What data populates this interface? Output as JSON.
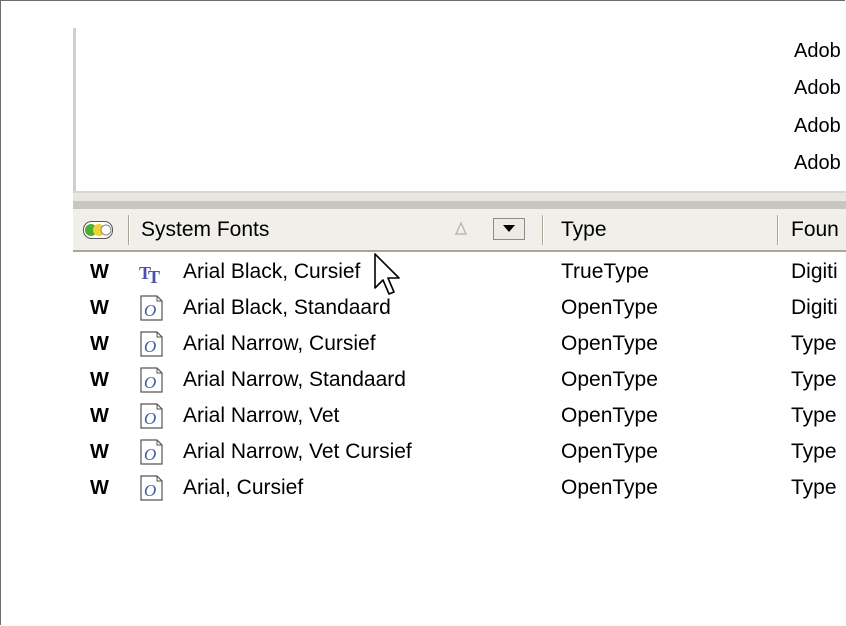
{
  "upper_pane": {
    "items": [
      "Adob",
      "Adob",
      "Adob",
      "Adob"
    ]
  },
  "header": {
    "col_name": "System Fonts",
    "col_type": "Type",
    "col_foundry": "Foun"
  },
  "rows": [
    {
      "mark": "W",
      "icon": "truetype-icon",
      "name": "Arial Black, Cursief",
      "type": "TrueType",
      "foundry": "Digiti"
    },
    {
      "mark": "W",
      "icon": "opentype-icon",
      "name": "Arial Black, Standaard",
      "type": "OpenType",
      "foundry": "Digiti"
    },
    {
      "mark": "W",
      "icon": "opentype-icon",
      "name": "Arial Narrow, Cursief",
      "type": "OpenType",
      "foundry": "Type"
    },
    {
      "mark": "W",
      "icon": "opentype-icon",
      "name": "Arial Narrow, Standaard",
      "type": "OpenType",
      "foundry": "Type"
    },
    {
      "mark": "W",
      "icon": "opentype-icon",
      "name": "Arial Narrow, Vet",
      "type": "OpenType",
      "foundry": "Type"
    },
    {
      "mark": "W",
      "icon": "opentype-icon",
      "name": "Arial Narrow, Vet Cursief",
      "type": "OpenType",
      "foundry": "Type"
    },
    {
      "mark": "W",
      "icon": "opentype-icon",
      "name": "Arial, Cursief",
      "type": "OpenType",
      "foundry": "Type"
    }
  ],
  "colors": {
    "status_green": "#4caf2f",
    "status_yellow": "#f2d230",
    "truetype_icon": "#4a4fb0",
    "opentype_icon": "#3a5fa0"
  }
}
